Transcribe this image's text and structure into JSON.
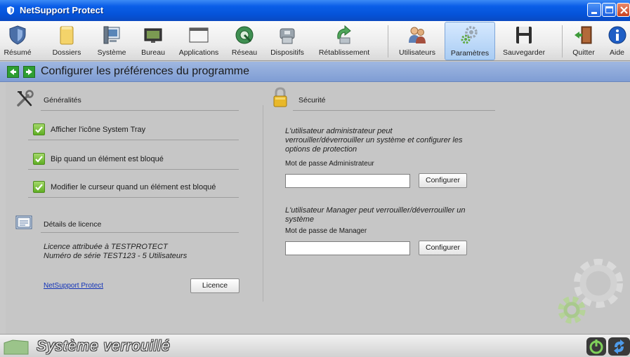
{
  "window": {
    "title": "NetSupport Protect"
  },
  "toolbar": {
    "items": [
      {
        "label": "Résumé",
        "icon": "shield-icon"
      },
      {
        "label": "Dossiers",
        "icon": "folder-icon"
      },
      {
        "label": "Système",
        "icon": "system-icon"
      },
      {
        "label": "Bureau",
        "icon": "desktop-icon"
      },
      {
        "label": "Applications",
        "icon": "window-icon"
      },
      {
        "label": "Réseau",
        "icon": "network-globe-icon"
      },
      {
        "label": "Dispositifs",
        "icon": "devices-icon"
      },
      {
        "label": "Rétablissement",
        "icon": "restore-icon"
      },
      {
        "label": "Utilisateurs",
        "icon": "users-icon"
      },
      {
        "label": "Paramètres",
        "icon": "gears-icon",
        "active": true
      },
      {
        "label": "Sauvegarder",
        "icon": "save-icon"
      },
      {
        "label": "Quitter",
        "icon": "exit-door-icon"
      },
      {
        "label": "Aide",
        "icon": "info-icon"
      }
    ]
  },
  "header": {
    "title": "Configurer les préférences du programme"
  },
  "general": {
    "title": "Généralités",
    "options": [
      {
        "label": "Afficher l'icône System Tray",
        "checked": true
      },
      {
        "label": "Bip quand un élément est bloqué",
        "checked": true
      },
      {
        "label": "Modifier le curseur quand un élément est bloqué",
        "checked": true
      }
    ]
  },
  "license": {
    "title": "Détails de licence",
    "line1": "Licence attribuée à TESTPROTECT",
    "line2": "Numéro de série TEST123 - 5 Utilisateurs",
    "link": "NetSupport Protect",
    "button": "Licence"
  },
  "security": {
    "title": "Sécurité",
    "admin_desc_1": "L'utilisateur administrateur peut",
    "admin_desc_2": "verrouiller/déverrouiller un système et configurer les",
    "admin_desc_3": "options de protection",
    "admin_label": "Mot de passe Administrateur",
    "admin_value": "",
    "admin_button": "Configurer",
    "manager_desc_1": "L'utilisateur Manager peut verrouiller/déverrouiller un",
    "manager_desc_2": "système",
    "manager_label": "Mot de passe de Manager",
    "manager_value": "",
    "manager_button": "Configurer"
  },
  "status": {
    "text": "Système verrouillé"
  },
  "colors": {
    "titlebar": "#0553d8",
    "header": "#8fa9db",
    "check": "#5fae23",
    "link": "#1233b8"
  }
}
